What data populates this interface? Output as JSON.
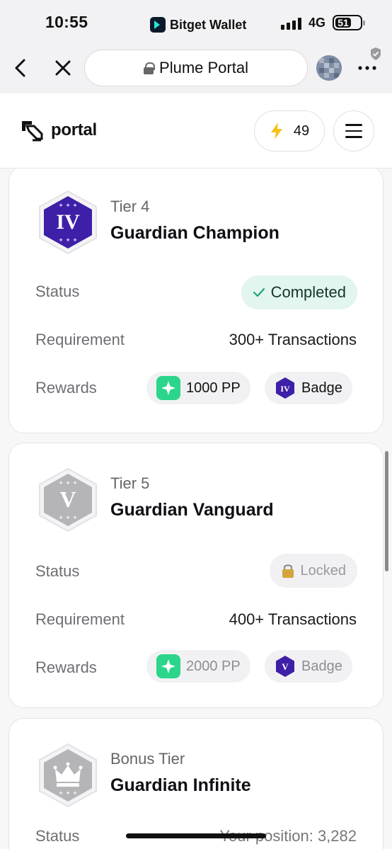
{
  "status_bar": {
    "time": "10:55",
    "app_name": "Bitget Wallet",
    "network": "4G",
    "battery": "51"
  },
  "browser": {
    "url_title": "Plume Portal",
    "icons": [
      "chevron-left-icon",
      "close-icon",
      "lock-icon",
      "wallet-avatar",
      "more-icon",
      "shield-icon"
    ]
  },
  "site_header": {
    "logo_text": "portal",
    "points": "49",
    "points_icon": "lightning-icon",
    "menu_icon": "hamburger-icon"
  },
  "tiers": [
    {
      "tier": "Tier 4",
      "name": "Guardian Champion",
      "badge_numeral": "IV",
      "badge_color": "#3d1fa8",
      "status_label": "Status",
      "status": "Completed",
      "status_type": "completed",
      "requirement_label": "Requirement",
      "requirement": "300+ Transactions",
      "rewards_label": "Rewards",
      "reward_points": "1000 PP",
      "reward_badge": "Badge",
      "reward_badge_numeral": "IV"
    },
    {
      "tier": "Tier 5",
      "name": "Guardian Vanguard",
      "badge_numeral": "V",
      "badge_color": "#b5b5b8",
      "status_label": "Status",
      "status": "Locked",
      "status_type": "locked",
      "requirement_label": "Requirement",
      "requirement": "400+ Transactions",
      "rewards_label": "Rewards",
      "reward_points": "2000 PP",
      "reward_badge": "Badge",
      "reward_badge_numeral": "V"
    },
    {
      "tier": "Bonus Tier",
      "name": "Guardian Infinite",
      "badge_icon": "crown-icon",
      "badge_color": "#b5b5b8",
      "status_label": "Status",
      "status": "Your position: 3,282"
    }
  ],
  "colors": {
    "accent_green": "#2bd58a",
    "completed_bg": "#e3f5ef",
    "badge_purple": "#3d1fa8"
  }
}
